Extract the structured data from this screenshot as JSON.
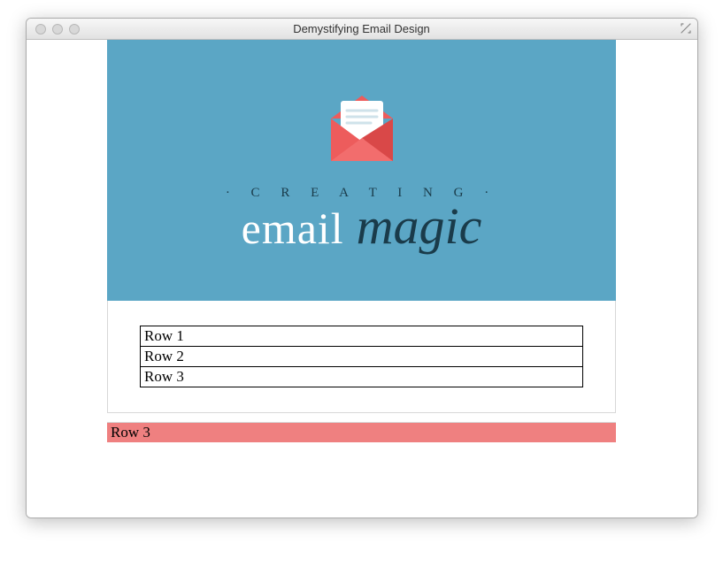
{
  "window": {
    "title": "Demystifying Email Design"
  },
  "hero": {
    "subtitle": "· C R E A T I N G ·",
    "title_word1": "email",
    "title_word2": "magic"
  },
  "content": {
    "rows": {
      "0": "Row 1",
      "1": "Row 2",
      "2": "Row 3"
    }
  },
  "footer": {
    "text": "Row 3"
  },
  "colors": {
    "hero_bg": "#5ba6c5",
    "envelope": "#ed5c5c",
    "envelope_dark": "#d94848",
    "paper": "#ffffff",
    "paper_lines": "#cfe2ea",
    "footer_bg": "#ef8080"
  }
}
